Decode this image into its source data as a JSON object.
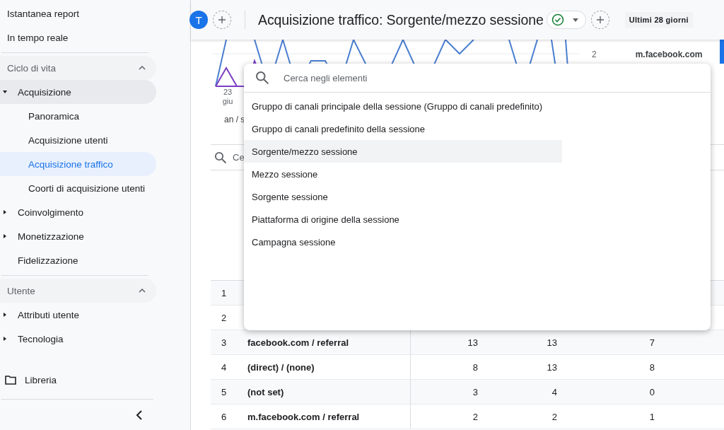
{
  "sidebar": {
    "top_items": [
      {
        "label": "Istantanea report",
        "selected": false
      },
      {
        "label": "In tempo reale",
        "selected": false
      }
    ],
    "sections": [
      {
        "title": "Ciclo di vita",
        "expanded": true,
        "items": [
          {
            "label": "Acquisizione",
            "expanded": true,
            "children": [
              {
                "label": "Panoramica",
                "selected": false
              },
              {
                "label": "Acquisizione utenti",
                "selected": false
              },
              {
                "label": "Acquisizione traffico",
                "selected": true
              },
              {
                "label": "Coorti di acquisizione utenti",
                "selected": false
              }
            ]
          },
          {
            "label": "Coinvolgimento",
            "expanded": false
          },
          {
            "label": "Monetizzazione",
            "expanded": false
          },
          {
            "label": "Fidelizzazione"
          }
        ]
      },
      {
        "title": "Utente",
        "expanded": true,
        "items": [
          {
            "label": "Attributi utente",
            "expanded": false
          },
          {
            "label": "Tecnologia",
            "expanded": false
          }
        ]
      }
    ],
    "library": "Libreria"
  },
  "header": {
    "avatar": "T",
    "title": "Acquisizione traffico: Sorgente/mezzo sessione",
    "date_range": "Ultimi 28 giorni"
  },
  "chart": {
    "x_label_day": "23",
    "x_label_month": "giu",
    "legend_fragment": "an / s",
    "right_value": "2",
    "right_label": "m.facebook.com"
  },
  "table_search": {
    "placeholder": "Ce"
  },
  "table": {
    "rows": [
      {
        "index": "1"
      },
      {
        "index": "2"
      },
      {
        "index": "3",
        "source": "facebook.com / referral",
        "values": [
          "13",
          "13",
          "7"
        ]
      },
      {
        "index": "4",
        "source": "(direct) / (none)",
        "values": [
          "8",
          "13",
          "8"
        ]
      },
      {
        "index": "5",
        "source": "(not set)",
        "values": [
          "3",
          "4",
          "0"
        ]
      },
      {
        "index": "6",
        "source": "m.facebook.com / referral",
        "values": [
          "2",
          "2",
          "1"
        ]
      }
    ]
  },
  "dimension_menu": {
    "search_placeholder": "Cerca negli elementi",
    "options": [
      {
        "label": "Gruppo di canali principale della sessione (Gruppo di canali predefinito)",
        "selected": false
      },
      {
        "label": "Gruppo di canali predefinito della sessione",
        "selected": false
      },
      {
        "label": "Sorgente/mezzo sessione",
        "selected": true
      },
      {
        "label": "Mezzo sessione",
        "selected": false
      },
      {
        "label": "Sorgente sessione",
        "selected": false
      },
      {
        "label": "Piattaforma di origine della sessione",
        "selected": false
      },
      {
        "label": "Campagna sessione",
        "selected": false
      }
    ]
  }
}
